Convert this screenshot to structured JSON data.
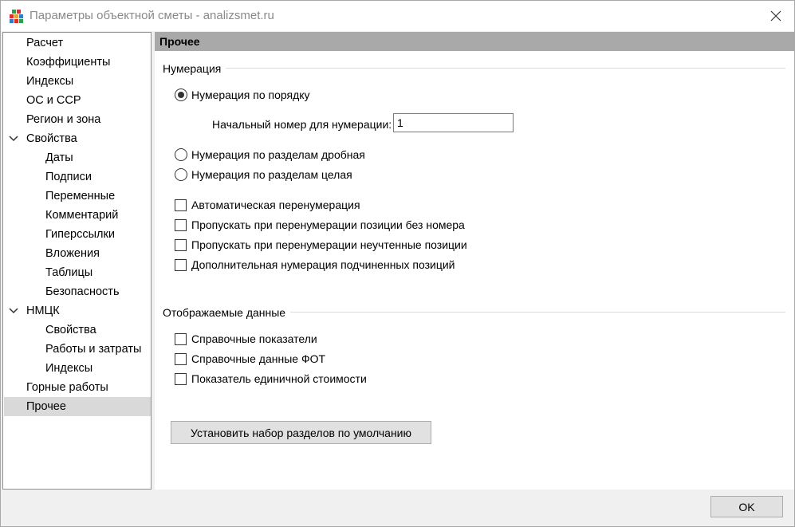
{
  "window": {
    "title": "Параметры объектной сметы - analizsmet.ru",
    "app_icon": "grid-app-icon",
    "close_icon": "close-icon"
  },
  "tree": {
    "items": [
      {
        "label": "Расчет",
        "level": 0
      },
      {
        "label": "Коэффициенты",
        "level": 0
      },
      {
        "label": "Индексы",
        "level": 0
      },
      {
        "label": "ОС и ССР",
        "level": 0
      },
      {
        "label": "Регион и зона",
        "level": 0
      },
      {
        "label": "Свойства",
        "level": 0,
        "expanded": true
      },
      {
        "label": "Даты",
        "level": 1
      },
      {
        "label": "Подписи",
        "level": 1
      },
      {
        "label": "Переменные",
        "level": 1
      },
      {
        "label": "Комментарий",
        "level": 1
      },
      {
        "label": "Гиперссылки",
        "level": 1
      },
      {
        "label": "Вложения",
        "level": 1
      },
      {
        "label": "Таблицы",
        "level": 1
      },
      {
        "label": "Безопасность",
        "level": 1
      },
      {
        "label": "НМЦК",
        "level": 0,
        "expanded": true
      },
      {
        "label": "Свойства",
        "level": 1
      },
      {
        "label": "Работы и затраты",
        "level": 1
      },
      {
        "label": "Индексы",
        "level": 1
      },
      {
        "label": "Горные работы",
        "level": 0
      },
      {
        "label": "Прочее",
        "level": 0,
        "selected": true
      }
    ]
  },
  "panel": {
    "header": "Прочее",
    "numbering": {
      "title": "Нумерация",
      "radio_ordered": "Нумерация по порядку",
      "start_label": "Начальный номер для нумерации:",
      "start_value": "1",
      "radio_fractional": "Нумерация по разделам дробная",
      "radio_whole": "Нумерация по разделам целая",
      "selected": "ordered",
      "cb_auto": "Автоматическая перенумерация",
      "cb_skip_no_number": "Пропускать при перенумерации позиции без номера",
      "cb_skip_unaccounted": "Пропускать при перенумерации неучтенные позиции",
      "cb_additional": "Дополнительная нумерация подчиненных позиций"
    },
    "display": {
      "title": "Отображаемые данные",
      "cb_reference_indicators": "Справочные показатели",
      "cb_reference_fot": "Справочные данные ФОТ",
      "cb_unit_cost": "Показатель единичной стоимости"
    },
    "default_button": "Установить набор разделов по умолчанию"
  },
  "footer": {
    "ok_label": "OK"
  },
  "colors": {
    "header_bg": "#a9a9a9",
    "selected_bg": "#d9d9d9",
    "window_bg": "#f0f0f0"
  }
}
